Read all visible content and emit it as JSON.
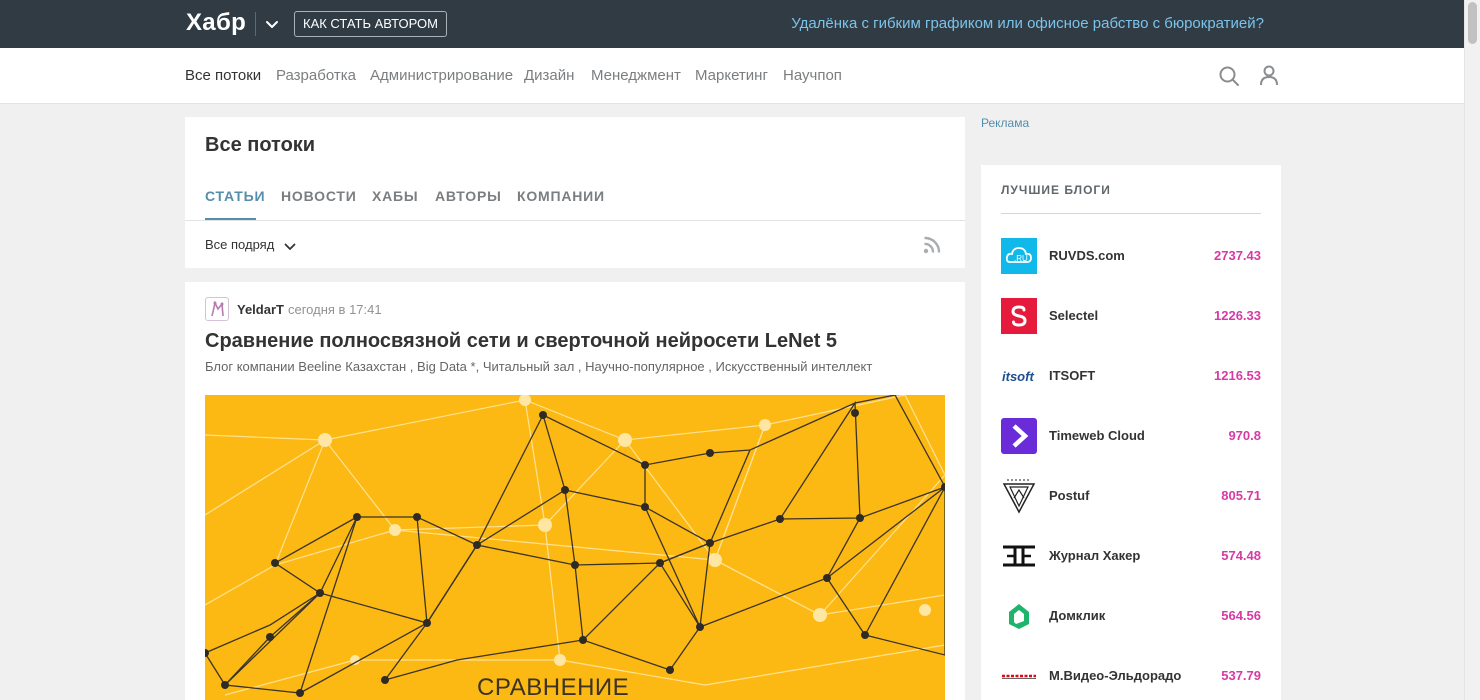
{
  "header": {
    "logo": "Хабр",
    "author_button": "КАК СТАТЬ АВТОРОМ",
    "promo": "Удалёнка с гибким графиком или офисное рабство с бюрократией?"
  },
  "nav": {
    "items": [
      {
        "label": "Все потоки",
        "active": true
      },
      {
        "label": "Разработка"
      },
      {
        "label": "Администрирование"
      },
      {
        "label": "Дизайн"
      },
      {
        "label": "Менеджмент"
      },
      {
        "label": "Маркетинг"
      },
      {
        "label": "Научпоп"
      }
    ],
    "icons": [
      "search-icon",
      "user-icon"
    ]
  },
  "feed": {
    "title": "Все потоки",
    "tabs": [
      {
        "label": "СТАТЬИ",
        "active": true
      },
      {
        "label": "НОВОСТИ"
      },
      {
        "label": "ХАБЫ"
      },
      {
        "label": "АВТОРЫ"
      },
      {
        "label": "КОМПАНИИ"
      }
    ],
    "filter": "Все подряд",
    "rss_icon": "rss-icon"
  },
  "article": {
    "author": "YeldarT",
    "time": "сегодня в 17:41",
    "title": "Сравнение полносвязной сети и сверточной нейросети LeNet 5",
    "hubs": [
      "Блог компании Beeline Казахстан",
      "Big Data *",
      "Читальный зал",
      "Научно-популярное",
      "Искусственный интеллект"
    ],
    "image_caption": "СРАВНЕНИЕ"
  },
  "sidebar": {
    "ad_label": "Реклама",
    "title": "ЛУЧШИЕ БЛОГИ",
    "blogs": [
      {
        "name": "RUVDS.com",
        "score": "2737.43",
        "logo": "ruvds-cloud-logo"
      },
      {
        "name": "Selectel",
        "score": "1226.33",
        "logo": "selectel-s-logo"
      },
      {
        "name": "ITSOFT",
        "score": "1216.53",
        "logo": "itsoft-logo",
        "logo_text": "itsoft"
      },
      {
        "name": "Timeweb Cloud",
        "score": "970.8",
        "logo": "timeweb-logo"
      },
      {
        "name": "Postuf",
        "score": "805.71",
        "logo": "postuf-logo"
      },
      {
        "name": "Журнал Хакер",
        "score": "574.48",
        "logo": "xakep-logo"
      },
      {
        "name": "Домклик",
        "score": "564.56",
        "logo": "domclick-logo"
      },
      {
        "name": "М.Видео-Эльдорадо",
        "score": "537.79",
        "logo": "mvideo-eldorado-logo"
      }
    ]
  },
  "colors": {
    "topbar": "#303b44",
    "accent": "#548eaa",
    "score": "#d73aa4",
    "promo": "#7cc3ea",
    "image_bg": "#fdb913"
  }
}
